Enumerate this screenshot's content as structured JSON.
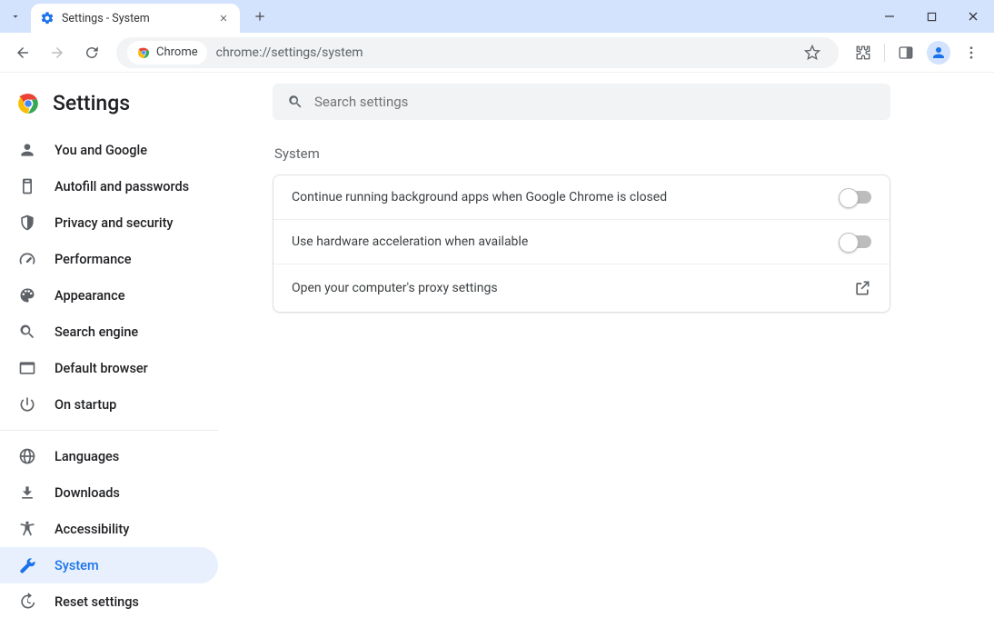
{
  "window": {
    "tab_title": "Settings - System"
  },
  "toolbar": {
    "site_chip": "Chrome",
    "url": "chrome://settings/system"
  },
  "app": {
    "title": "Settings"
  },
  "search": {
    "placeholder": "Search settings"
  },
  "sidebar": {
    "items": [
      {
        "id": "you-and-google",
        "label": "You and Google"
      },
      {
        "id": "autofill",
        "label": "Autofill and passwords"
      },
      {
        "id": "privacy",
        "label": "Privacy and security"
      },
      {
        "id": "performance",
        "label": "Performance"
      },
      {
        "id": "appearance",
        "label": "Appearance"
      },
      {
        "id": "search-engine",
        "label": "Search engine"
      },
      {
        "id": "default-browser",
        "label": "Default browser"
      },
      {
        "id": "on-startup",
        "label": "On startup"
      },
      {
        "id": "languages",
        "label": "Languages"
      },
      {
        "id": "downloads",
        "label": "Downloads"
      },
      {
        "id": "accessibility",
        "label": "Accessibility"
      },
      {
        "id": "system",
        "label": "System"
      },
      {
        "id": "reset",
        "label": "Reset settings"
      }
    ]
  },
  "section": {
    "title": "System",
    "rows": {
      "bg_apps": "Continue running background apps when Google Chrome is closed",
      "hw_accel": "Use hardware acceleration when available",
      "proxy": "Open your computer's proxy settings"
    },
    "toggles": {
      "bg_apps": false,
      "hw_accel": false
    }
  }
}
